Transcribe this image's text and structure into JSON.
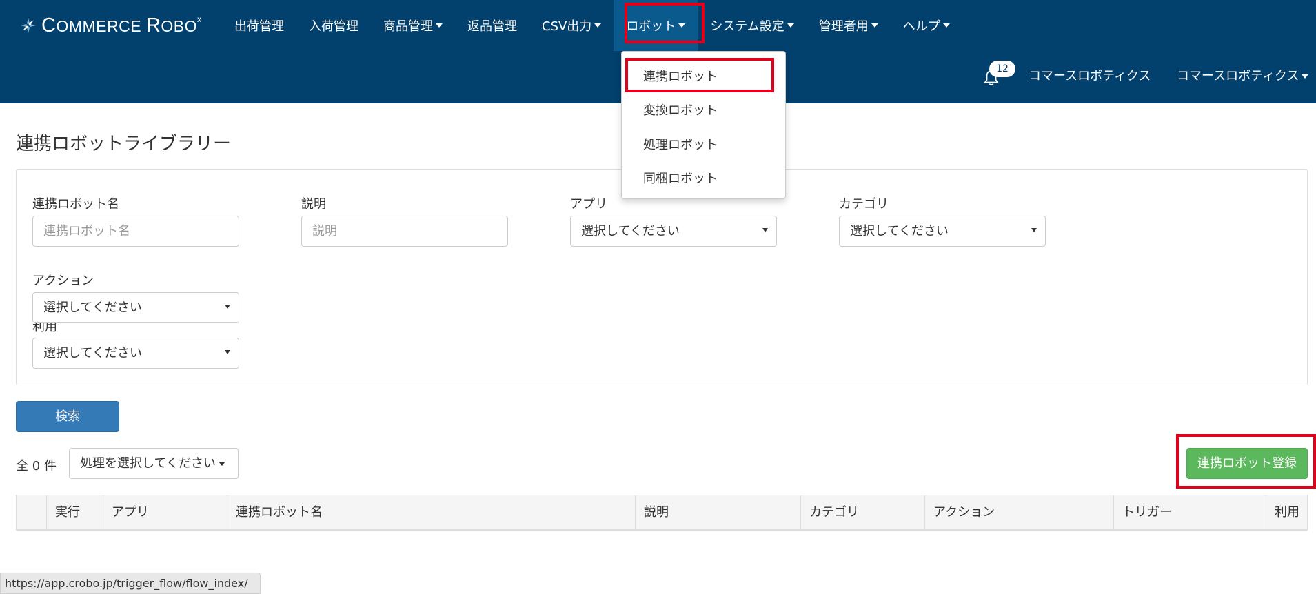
{
  "nav": {
    "logo_prefix": "C",
    "logo_mid": "OMMERCE ",
    "logo_r": "R",
    "logo_suffix": "OBO",
    "logo_mark": "x",
    "items": [
      {
        "label": "出荷管理",
        "has_caret": false
      },
      {
        "label": "入荷管理",
        "has_caret": false
      },
      {
        "label": "商品管理",
        "has_caret": true
      },
      {
        "label": "返品管理",
        "has_caret": false
      },
      {
        "label": "CSV出力",
        "has_caret": true
      },
      {
        "label": "ロボット",
        "has_caret": true,
        "active": true
      },
      {
        "label": "システム設定",
        "has_caret": true
      },
      {
        "label": "管理者用",
        "has_caret": true
      },
      {
        "label": "ヘルプ",
        "has_caret": true
      }
    ],
    "notification_count": "12",
    "user_company": "コマースロボティクス",
    "user_menu": "コマースロボティクス"
  },
  "dropdown": {
    "items": [
      "連携ロボット",
      "変換ロボット",
      "処理ロボット",
      "同梱ロボット"
    ]
  },
  "page": {
    "title": "連携ロボットライブラリー"
  },
  "search": {
    "robot_name_label": "連携ロボット名",
    "robot_name_placeholder": "連携ロボット名",
    "description_label": "説明",
    "description_placeholder": "説明",
    "app_label": "アプリ",
    "app_value": "選択してください",
    "category_label": "カテゴリ",
    "category_value": "選択してください",
    "action_label": "アクション",
    "action_value": "選択してください",
    "usage_label": "利用",
    "usage_value": "選択してください",
    "search_button": "検索"
  },
  "list": {
    "count_text": "全 0 件",
    "bulk_action": "処理を選択してください",
    "register_button": "連携ロボット登録",
    "columns": [
      "実行",
      "アプリ",
      "連携ロボット名",
      "説明",
      "カテゴリ",
      "アクション",
      "トリガー",
      "利用"
    ]
  },
  "status_bar": {
    "url": "https://app.crobo.jp/trigger_flow/flow_index/"
  },
  "colors": {
    "navbar": "#02406d",
    "active_nav": "#0a5a8e",
    "highlight": "#e3001b",
    "primary_button": "#337ab7",
    "success_button": "#5cb85c"
  }
}
